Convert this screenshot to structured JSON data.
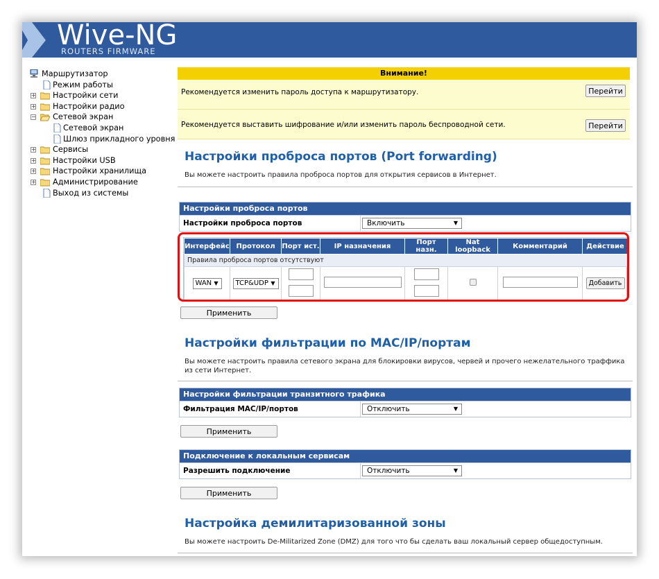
{
  "header": {
    "title": "Wive-NG",
    "subtitle": "ROUTERS FIRMWARE",
    "brand_color": "#2f5a9e"
  },
  "tree": {
    "root": "Маршрутизатор",
    "items": [
      {
        "label": "Режим работы"
      },
      {
        "label": "Настройки сети"
      },
      {
        "label": "Настройки радио"
      },
      {
        "label": "Сетевой экран"
      },
      {
        "label": "Сетевой экран"
      },
      {
        "label": "Шлюз прикладного уровня"
      },
      {
        "label": "Сервисы"
      },
      {
        "label": "Настройки USB"
      },
      {
        "label": "Настройки хранилища"
      },
      {
        "label": "Администрирование"
      },
      {
        "label": "Выход из системы"
      }
    ]
  },
  "warning": {
    "title": "Внимание!",
    "rows": [
      {
        "text": "Рекомендуется изменить пароль доступа к маршрутизатору.",
        "button": "Перейти"
      },
      {
        "text": "Рекомендуется выставить шифрование и/или изменить пароль беспроводной сети.",
        "button": "Перейти"
      }
    ]
  },
  "port_forwarding": {
    "title": "Настройки проброса портов (Port forwarding)",
    "description": "Вы можете настроить правила проброса портов для открытия сервисов в Интернет.",
    "panel_title": "Настройки проброса портов",
    "row_label": "Настройки проброса портов",
    "row_value": "Включить",
    "columns": [
      "Интерфейс",
      "Протокол",
      "Порт ист.",
      "IP назначения",
      "Порт назн.",
      "Nat loopback",
      "Комментарий",
      "Действие"
    ],
    "empty_text": "Правила проброса портов отсутствуют",
    "interface_value": "WAN",
    "protocol_value": "TCP&UDP",
    "add_button": "Добавить",
    "apply_button": "Применить"
  },
  "filtering": {
    "title": "Настройки фильтрации по MAC/IP/портам",
    "description": "Вы можете настроить правила сетевого экрана для блокировки вирусов, червей и прочего нежелательного траффика из сети Интернет.",
    "panel_title": "Настройки фильтрации транзитного трафика",
    "row_label": "Фильтрация MAC/IP/портов",
    "row_value": "Отключить",
    "apply_button": "Применить"
  },
  "local_services": {
    "panel_title": "Подключение к локальным сервисам",
    "row_label": "Разрешить подключение",
    "row_value": "Отключить",
    "apply_button": "Применить"
  },
  "dmz": {
    "title": "Настройка демилитаризованной зоны",
    "description": "Вы можете настроить De-Militarized Zone (DMZ) для того что бы сделать ваш локальный сервер общедоступным."
  },
  "icons": {
    "root": "computer-icon",
    "page": "page-icon",
    "folder": "folder-icon",
    "expander": "plus-minus-icon",
    "dropdown": "chevron-down-icon"
  }
}
